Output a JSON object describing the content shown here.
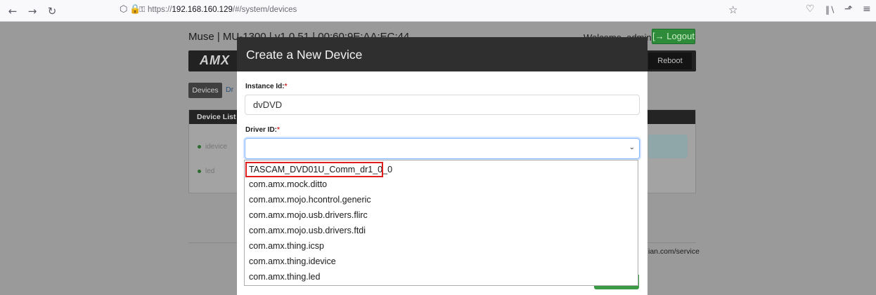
{
  "browser": {
    "back_icon": "←",
    "forward_icon": "→",
    "reload_icon": "↻",
    "url_prefix": "https://",
    "url_host": "192.168.160.129",
    "url_path": "/#/system/devices",
    "icons": [
      "shield-icon",
      "lock-icon",
      "key-icon",
      "star-icon",
      "pocket-icon",
      "library-icon",
      "extensions-icon",
      "menu-icon"
    ]
  },
  "page": {
    "header": "Muse | MU-1300 | v1.0.51 | 00:60:9E:AA:EC:44",
    "welcome": "Welcome, admin",
    "logout_label": "[→ Logout",
    "logo": "AMX",
    "reboot_label": "Reboot",
    "tabs": [
      "Devices",
      "Dr"
    ],
    "panel_title": "Device List",
    "devices": [
      "idevice",
      "led"
    ],
    "footer_link": "ian.com/service"
  },
  "modal": {
    "title": "Create a New Device",
    "instance_label": "Instance Id:",
    "instance_value": "dvDVD",
    "driver_label": "Driver ID:",
    "required_mark": "*",
    "driver_value": "",
    "chevron": "⌄",
    "driver_options": [
      "TASCAM_DVD01U_Comm_dr1_0_0",
      "com.amx.mock.ditto",
      "com.amx.mojo.hcontrol.generic",
      "com.amx.mojo.usb.drivers.flirc",
      "com.amx.mojo.usb.drivers.ftdi",
      "com.amx.thing.icsp",
      "com.amx.thing.idevice",
      "com.amx.thing.led"
    ]
  },
  "colors": {
    "highlight": "#e11d1d",
    "overlay": "#9a9a9a",
    "modal_header": "#2f2f2f",
    "accent_green": "#3a9a46"
  }
}
